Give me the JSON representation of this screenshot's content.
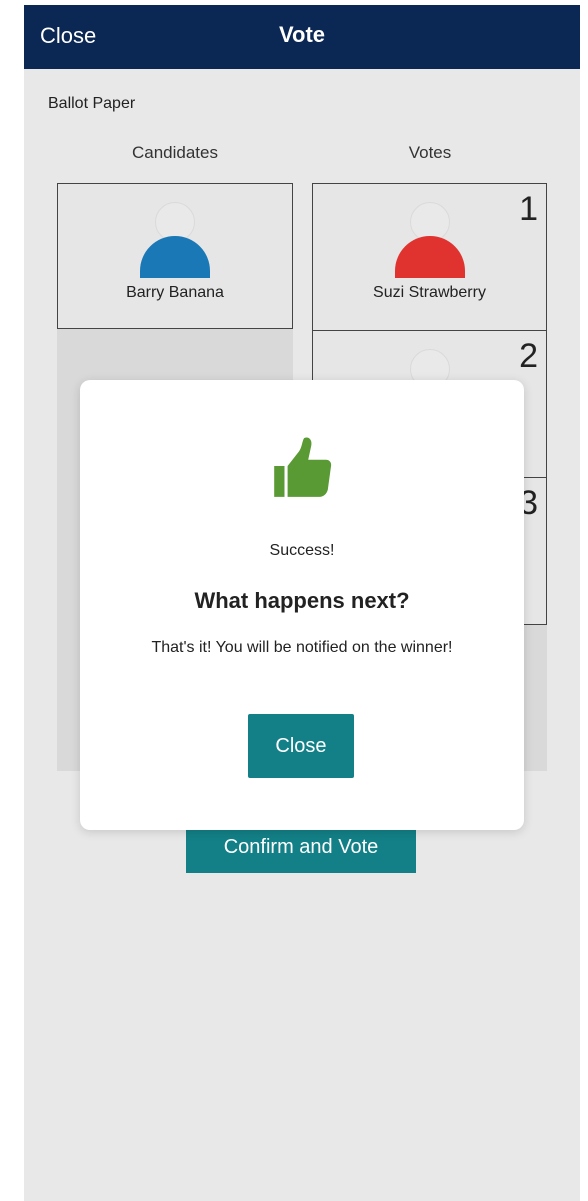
{
  "header": {
    "close_label": "Close",
    "title": "Vote"
  },
  "ballot": {
    "label": "Ballot Paper",
    "candidates_header": "Candidates",
    "votes_header": "Votes",
    "candidates": [
      {
        "name": "Barry Banana",
        "color": "#1b78b6"
      }
    ],
    "votes": [
      {
        "rank": "1",
        "name": "Suzi Strawberry",
        "color": "#e0322e"
      },
      {
        "rank": "2",
        "name": ""
      },
      {
        "rank": "3",
        "name": ""
      }
    ]
  },
  "dialog": {
    "icon": "thumbs-up-icon",
    "icon_color": "#5a9a35",
    "status": "Success!",
    "heading": "What happens next?",
    "message": "That's it! You will be notified on the winner!",
    "close_label": "Close"
  },
  "confirm_label": "Confirm and Vote",
  "colors": {
    "header_bg": "#0b2753",
    "accent": "#138087"
  }
}
